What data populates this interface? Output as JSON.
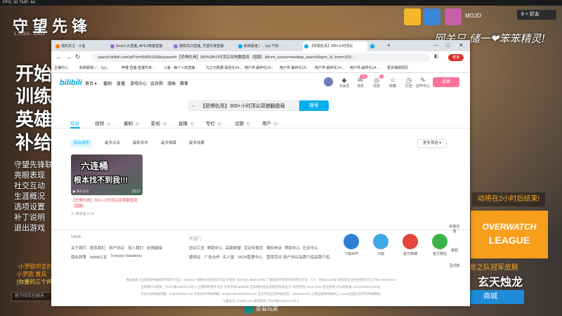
{
  "game": {
    "topstrip": "FPS: 30    TMP: 44",
    "logo": "守望先锋",
    "version": "1.70.0.0 - 10413",
    "menu_big": [
      "开始",
      "训练",
      "英雄",
      "补给"
    ],
    "menu_small": [
      "守望先锋联",
      "亮眼表现",
      "社交互动",
      "生涯概况",
      "选项设置",
      "补丁说明",
      "退出游戏"
    ],
    "orange_links": [
      "·小罗欧中正的",
      "小罗欧 黄兵",
      "[你要的三个鸡]"
    ],
    "chat_placeholder": "按下回车在聊天",
    "player_name": "MOJO",
    "friends_label": "8 + 好友",
    "handwriting": "网关只 储一❤笨笨精灵!",
    "event_banner": "动将在2小时后结束!",
    "owl_line1": "OVERWATCH",
    "owl_line2": "LEAGUE",
    "skin_line1": "龙之队冠军皮肤",
    "skin_line2": "玄天烛龙",
    "shop_label": "商城",
    "bottom_label": "查看玩家"
  },
  "browser": {
    "tabs": [
      {
        "label": "我的关注 - 斗鱼",
        "color": "#ff7a00"
      },
      {
        "label": "Seal三大直播_APEX英雄直播",
        "color": "#9a6bd6"
      },
      {
        "label": "钢铁先22直播_守望先锋直播",
        "color": "#9a6bd6"
      },
      {
        "label": "粉褥蒙继 | '←'(ω) 千秒 -",
        "color": "#00aeec"
      },
      {
        "label": "【恐惧仇焉】300+小时顶尖",
        "color": "#00aeec"
      },
      {
        "label": "",
        "color": "#00aeec"
      }
    ],
    "url": "search.bilibili.com/all?vt=65455100&keyword=【恐惧仇焉】300%2B小时顶尖双地翻盘局（国服）&from_source=webtop_search&spm_id_from=333...",
    "error_label": "错误",
    "bookmarks": [
      "主播中心",
      "粉褥蒙继 | '←'(ω)...",
      "哔哩 直播-直播节目...",
      "斗鱼 - 每个人的直播...",
      "元之元数据·最佳化14...",
      "用户界-最终化14...",
      "用户界-最终化14...",
      "用户界-最终化14...",
      "用户界-最终化14...",
      "更多播放网页"
    ],
    "bili": {
      "logo": "bilibili",
      "nav": [
        "首页 ▾",
        "番剧",
        "直播",
        "游戏中心",
        "会员购",
        "漫画",
        "赛事"
      ],
      "icons": [
        {
          "label": "大会员",
          "glyph": "◆"
        },
        {
          "label": "消息",
          "glyph": "✉",
          "badge": "29+"
        },
        {
          "label": "动态",
          "glyph": "◎",
          "badge": "1"
        },
        {
          "label": "收藏",
          "glyph": "☆"
        },
        {
          "label": "历史",
          "glyph": "◷"
        },
        {
          "label": "创作中心",
          "glyph": "✎"
        }
      ],
      "upload_label": "投稿",
      "search_query": "【恐惧仇焉】300+小时顶尖双狼翻盘局",
      "search_button": "搜索",
      "categories": [
        {
          "label": "综合",
          "count": ""
        },
        {
          "label": "视频",
          "count": "1"
        },
        {
          "label": "番剧",
          "count": "0"
        },
        {
          "label": "影视",
          "count": "0"
        },
        {
          "label": "直播",
          "count": "0"
        },
        {
          "label": "专栏",
          "count": "0"
        },
        {
          "label": "话题",
          "count": "0"
        },
        {
          "label": "用户",
          "count": "0"
        }
      ],
      "filters": [
        "综合排序",
        "最多点击",
        "最新发布",
        "最多弹幕",
        "最多收藏"
      ],
      "more_filter": "更多筛选 ▾",
      "video": {
        "thumb_top": "六连桶",
        "thumb_bottom": "根本找不到我!!!",
        "thumb_stats": "▶ 9.0   ⊡ 0",
        "duration": "23:17",
        "title": "【恐惧仇焉】300+小时顶尖双狼翻盘局（国服）",
        "meta": "⓪ 两倍速    3-18"
      },
      "footer": {
        "col1_title": "bilibili",
        "col1_row1": [
          "关于我们",
          "联系我们",
          "用户协议",
          "加入我们",
          "友情链接"
        ],
        "col1_row2": [
          "隐私政策",
          "bilibili认证",
          "Investor Relations"
        ],
        "col2_title": "传送门",
        "col2_row1": [
          "协议汇总",
          "帮助中心",
          "高能联盟",
          "活动专题页",
          "侵权申诉",
          "帮助中心",
          "社区中心"
        ],
        "col2_row2": [
          "壁纸站",
          "广告合作",
          "名人堂",
          "MCN管理中心",
          "营销活动",
          "用户协议",
          "品牌介绍",
          "品牌介绍"
        ],
        "apps": [
          {
            "label": "下载APP",
            "color": "#2d7fd4"
          },
          {
            "label": "只能",
            "color": "#3fa9e5"
          },
          {
            "label": "官方微博",
            "color": "#e2463c"
          },
          {
            "label": "官方微信",
            "color": "#3bb34a"
          }
        ],
        "side_tools": [
          "新版反馈",
          "客服",
          "回顶部"
        ],
        "legal": [
          "营业执照   信息网络传播视听节目许可证：0910417   网络文化经营许可证 沪网文【2019】3804-274号   广播电视节目制作经营许可证：（沪）字第01248号   增值电信业务经营许可证 沪B2-20100043",
          "互联网ICP备案：沪ICP备13002172号-3   出版物经营许可证 沪批字第U6699号   互联网药品信息服务资格证 沪-非经营性-2016-0143   营业执照   沪公网安备 31011002002436号",
          "不良信息举报邮箱：help@bilibili.com   涉未成年举报邮箱：8neiproduct@bilibili.com   违法不良信息举报电话：4006262233   上海互联网举报中心   12318全国文化市场举报网站",
          "儿童协议   ©bilibili.com 版权所有   沪ICP备13002172号-3"
        ]
      }
    }
  }
}
